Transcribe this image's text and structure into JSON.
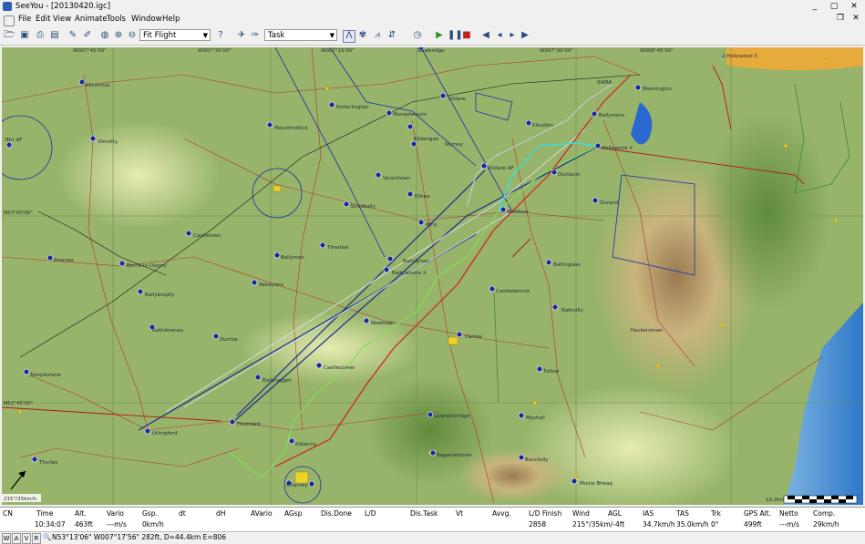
{
  "window": {
    "title": "SeeYou - [20130420.igc]",
    "min": "_",
    "max": "▢",
    "close": "✕"
  },
  "menu": [
    "File",
    "Edit",
    "View",
    "Animate",
    "Tools",
    "Window",
    "Help"
  ],
  "toolbar": {
    "zoom_mode": "Fit Flight",
    "view_mode": "Task"
  },
  "map": {
    "coords": [
      "W007°45'00\"",
      "W007°30'00\"",
      "W007°15'00\"",
      "W007°00'00\"",
      "W006°45'00\"",
      "N53°00'00\"",
      "N52°45'00\""
    ],
    "places": [
      "Kilcormac",
      "Kinnitty",
      "Birr AF",
      "Portarlington",
      "Monasterevin",
      "Kildare",
      "Newbridge",
      "Mountmellick",
      "Kildangan",
      "Nurney",
      "Ballymore",
      "Blessington",
      "Hollywood X",
      "2.Hollywood X",
      "Kilcullen",
      "Kildare AF",
      "Dunlavin",
      "Vicarstown",
      "Athy",
      "Kilkea",
      "Castledermot",
      "Ballitore",
      "Donard",
      "Stradbally",
      "Timahoe",
      "Ballyroan",
      "Abbeyleix",
      "Castletown",
      "Borris-in-Ossory",
      "Roscrea",
      "Ballybrophy",
      "Rathdowney",
      "Durrow",
      "Ballylynan",
      "Ballylehane X",
      "Newtown",
      "Rathvilly",
      "Baltinglass",
      "Hackerstown",
      "Carlow",
      "Tullow",
      "Castlecomer",
      "Ballyragget",
      "Freshford",
      "Urlingford",
      "Templemore",
      "Thurles",
      "Leighlinbridge",
      "Bagenalstown",
      "Myshall",
      "Bunclody",
      "Muine Bheag",
      "Killarney X",
      "Kilkenny",
      "SWRA",
      "Castlebridge",
      "Graiguecullen",
      "Kilcooley",
      "Ballinakill"
    ],
    "wind": "215°/35km/h",
    "scale": "10.2km",
    "sector_label": "2.Hollywood X"
  },
  "table": {
    "headers": [
      "CN",
      "Time",
      "Alt.",
      "Vario",
      "Gsp.",
      "dt",
      "dH",
      "AVario",
      "AGsp",
      "Dis.Done",
      "L/D",
      "Dis.Task",
      "Vt",
      "Avvg.",
      "L/D Finish",
      "Wind",
      "AGL",
      "IAS",
      "TAS",
      "Trk",
      "GPS Alt.",
      "Netto",
      "Comp."
    ],
    "values": [
      "",
      "10:34:07",
      "463ft",
      "---m/s",
      "0km/h",
      "",
      "",
      "",
      "",
      "",
      "",
      "",
      "",
      "",
      "2858",
      "215°/35km/-4ft",
      "",
      "34.7km/h",
      "35.0km/h",
      "0°",
      "499ft",
      "---m/s",
      "29km/h"
    ]
  },
  "status": {
    "tabs": [
      "W",
      "A",
      "V",
      "R"
    ],
    "position": "N53°13'06\"  W007°17'56\"  282ft, D=44.4km E=806"
  },
  "colors": {
    "track_green": "#7ee05a",
    "track_cyan": "#39e0e0",
    "track_grey": "#c8c8c8",
    "airspace_blue": "#1a2ea8",
    "roads_red": "#c0302a",
    "task_black": "#1a1a1a"
  }
}
